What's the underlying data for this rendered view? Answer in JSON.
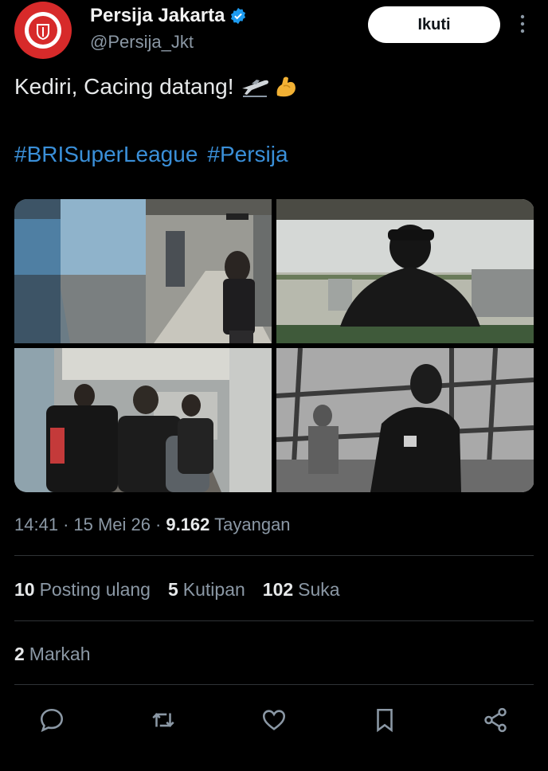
{
  "account": {
    "display_name": "Persija Jakarta",
    "handle": "@Persija_Jkt",
    "verified_icon": "verified-badge-icon",
    "avatar_icon": "persija-crest-icon"
  },
  "follow_label": "Ikuti",
  "tweet": {
    "text": "Kediri, Cacing datang!",
    "emoji": [
      "airplane-departure",
      "flexed-biceps"
    ],
    "hashtags": [
      "#BRISuperLeague",
      "#Persija"
    ]
  },
  "media": [
    {
      "name": "airport-corridor-player-cap"
    },
    {
      "name": "silhouette-player-window"
    },
    {
      "name": "players-walking-jet-bridge"
    },
    {
      "name": "player-monochrome-terminal"
    }
  ],
  "meta": {
    "time": "14:41",
    "date": "15 Mei 26",
    "views_count": "9.162",
    "views_label": "Tayangan"
  },
  "stats": {
    "reposts_count": "10",
    "reposts_label": "Posting ulang",
    "quotes_count": "5",
    "quotes_label": "Kutipan",
    "likes_count": "102",
    "likes_label": "Suka",
    "bookmarks_count": "2",
    "bookmarks_label": "Markah"
  },
  "colors": {
    "background": "#000000",
    "hashtag": "#3a8fd8",
    "secondary_text": "#8b98a5",
    "avatar": "#d72a2a",
    "verified": "#1d9bf0"
  }
}
